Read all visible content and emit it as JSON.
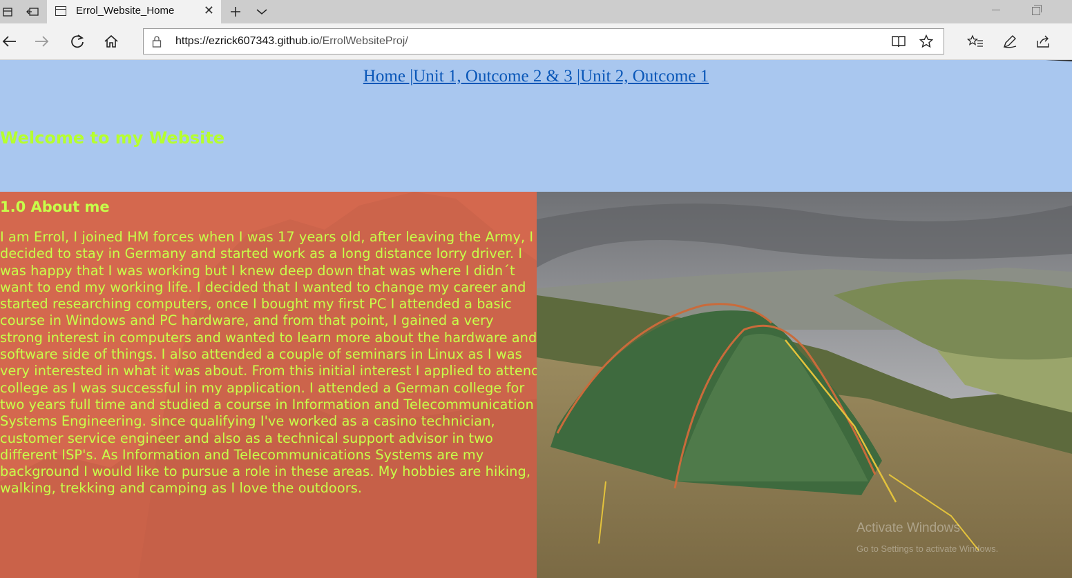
{
  "browser": {
    "tab_title": "Errol_Website_Home",
    "url_prefix": "https://",
    "url_host": "ezrick607343.github.io",
    "url_path": "/ErrolWebsiteProj/"
  },
  "nav": {
    "links": [
      "Home |",
      "Unit 1, Outcome 2 & 3 |",
      "Unit 2, Outcome 1"
    ]
  },
  "hero": {
    "heading": "Welcome to my Website"
  },
  "about": {
    "heading": "1.0 About me",
    "body": "I am Errol, I joined HM forces when I was 17 years old, after leaving the Army, I decided to stay in Germany and started work as a long distance lorry driver. I was happy that I was working but I knew deep down that was where I didn´t want to end my working life. I decided that I wanted to change my career and started researching computers, once I bought my first PC I attended a basic course in Windows and PC hardware, and from that point, I gained a very strong interest in computers and wanted to learn more about the hardware and software side of things. I also attended a couple of seminars in Linux as I was very interested in what it was about. From this initial interest I applied to attend college as I was successful in my application. I attended a German college for two years full time and studied a course in Information and Telecommunication Systems Engineering. since qualifying I've worked as a casino technician, customer service engineer and also as a technical support advisor in two different ISP's. As Information and Telecommunications Systems are my background I would like to pursue a role in these areas. My hobbies are hiking, walking, trekking and camping as I love the outdoors."
  },
  "watermark": {
    "line1": "Activate Windows",
    "line2": "Go to Settings to activate Windows."
  },
  "colors": {
    "sky": "#a9c7ef",
    "about_bg": "#d4684e",
    "accent_text": "#c7ff4a",
    "link": "#0a57b8"
  }
}
